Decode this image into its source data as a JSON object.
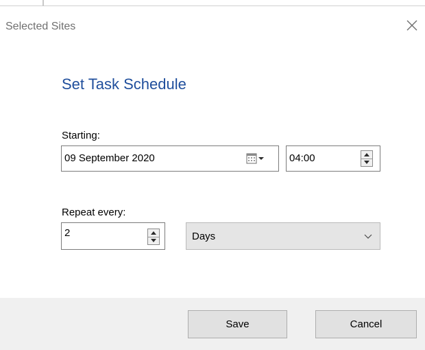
{
  "dialog": {
    "title": "Selected Sites",
    "heading": "Set Task Schedule"
  },
  "icons": {
    "close": "close-icon",
    "calendar": "calendar-icon",
    "dropdown": "chevron-down-icon",
    "spin_up": "arrow-up-icon",
    "spin_down": "arrow-down-icon"
  },
  "starting": {
    "label": "Starting:",
    "date": "09 September 2020",
    "time": "04:00"
  },
  "repeat": {
    "label": "Repeat every:",
    "value": "2",
    "unit": "Days"
  },
  "buttons": {
    "save": "Save",
    "cancel": "Cancel"
  },
  "colors": {
    "heading": "#1f4e9c",
    "title": "#707070",
    "footer": "#f0f0f0",
    "button": "#e1e1e1",
    "dropdown": "#e5e5e5"
  }
}
